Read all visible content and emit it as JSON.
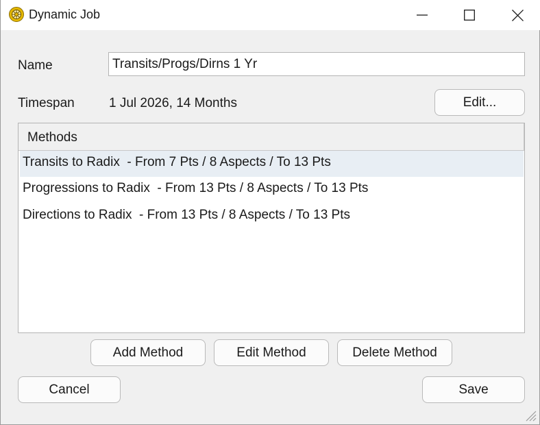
{
  "window": {
    "title": "Dynamic Job",
    "app_icon": "sun-wheel-icon",
    "controls": {
      "minimize": "minimize-icon",
      "maximize": "maximize-icon",
      "close": "close-icon"
    }
  },
  "form": {
    "name_label": "Name",
    "name_value": "Transits/Progs/Dirns 1 Yr",
    "timespan_label": "Timespan",
    "timespan_value": "1 Jul 2026, 14 Months",
    "edit_label": "Edit..."
  },
  "methods": {
    "header": "Methods",
    "items": [
      "Transits to Radix  - From 7 Pts / 8 Aspects / To 13 Pts",
      "Progressions to Radix  - From 13 Pts / 8 Aspects / To 13 Pts",
      "Directions to Radix  - From 13 Pts / 8 Aspects / To 13 Pts"
    ],
    "selected_index": 0
  },
  "method_buttons": {
    "add": "Add Method",
    "edit": "Edit Method",
    "delete": "Delete Method"
  },
  "footer": {
    "cancel": "Cancel",
    "save": "Save"
  },
  "colors": {
    "accent_icon": "#e5b800",
    "selection": "#e8eef4"
  }
}
